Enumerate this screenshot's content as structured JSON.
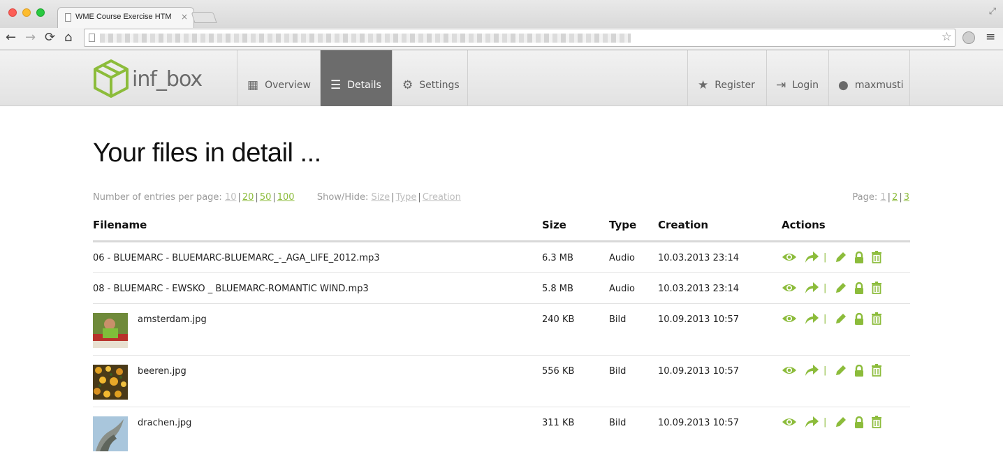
{
  "browser": {
    "tab_title": "WME Course Exercise HTM",
    "tab_close": "×",
    "nav": {
      "back": "←",
      "forward": "→",
      "reload": "⟳",
      "home": "⌂"
    },
    "star": "☆",
    "menu": "≡",
    "fullscreen": "⤢"
  },
  "header": {
    "logo_text": "inf_box",
    "nav": [
      {
        "label": "Overview",
        "icon": "grid-icon",
        "glyph": "▦"
      },
      {
        "label": "Details",
        "icon": "list-icon",
        "glyph": "☰"
      },
      {
        "label": "Settings",
        "icon": "gear-icon",
        "glyph": "⚙"
      }
    ],
    "right_nav": [
      {
        "label": "Register",
        "icon": "star-icon",
        "glyph": "★"
      },
      {
        "label": "Login",
        "icon": "login-icon",
        "glyph": "⇥"
      },
      {
        "label": "maxmusti",
        "icon": "user-icon",
        "glyph": "●"
      }
    ]
  },
  "main": {
    "title": "Your files in detail ...",
    "entries_label": "Number of entries per page:",
    "entries_options": [
      "10",
      "20",
      "50",
      "100"
    ],
    "showhide_label": "Show/Hide:",
    "showhide_options": [
      "Size",
      "Type",
      "Creation"
    ],
    "page_label": "Page:",
    "pages": [
      "1",
      "2",
      "3"
    ],
    "columns": [
      "Filename",
      "Size",
      "Type",
      "Creation",
      "Actions"
    ],
    "rows": [
      {
        "filename": "06 - BLUEMARC - BLUEMARC-BLUEMARC_-_AGA_LIFE_2012.mp3",
        "size": "6.3 MB",
        "type": "Audio",
        "creation": "10.03.2013 23:14"
      },
      {
        "filename": "08 - BLUEMARC - EWSKO _ BLUEMARC-ROMANTIC WIND.mp3",
        "size": "5.8 MB",
        "type": "Audio",
        "creation": "10.03.2013 23:14"
      },
      {
        "filename": "amsterdam.jpg",
        "size": "240 KB",
        "type": "Bild",
        "creation": "10.09.2013 10:57"
      },
      {
        "filename": "beeren.jpg",
        "size": "556 KB",
        "type": "Bild",
        "creation": "10.09.2013 10:57"
      },
      {
        "filename": "drachen.jpg",
        "size": "311 KB",
        "type": "Bild",
        "creation": "10.09.2013 10:57"
      }
    ],
    "action_separator": "|"
  },
  "colors": {
    "accent": "#8cbc3b",
    "nav_active": "#6c6c6c",
    "text": "#111111",
    "muted": "#9a9a9a"
  }
}
